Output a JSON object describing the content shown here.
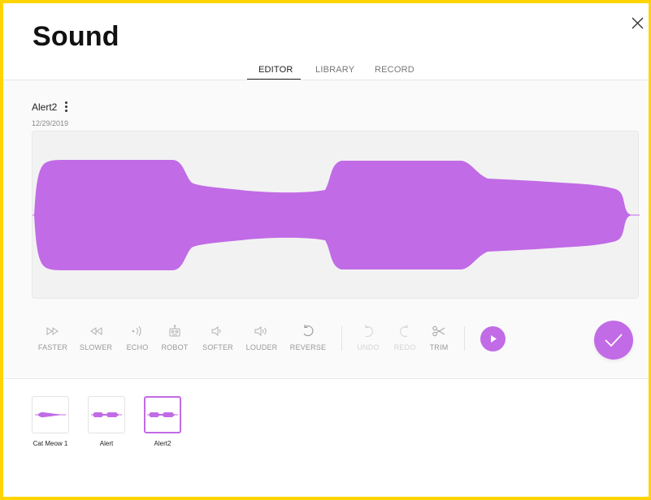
{
  "page": {
    "title": "Sound"
  },
  "tabs": [
    {
      "label": "EDITOR",
      "active": true
    },
    {
      "label": "LIBRARY",
      "active": false
    },
    {
      "label": "RECORD",
      "active": false
    }
  ],
  "sound": {
    "name": "Alert2",
    "date": "12/29/2019"
  },
  "tools": [
    {
      "label": "FASTER",
      "icon": "fast-forward-icon",
      "enabled": true
    },
    {
      "label": "SLOWER",
      "icon": "rewind-icon",
      "enabled": true
    },
    {
      "label": "ECHO",
      "icon": "echo-icon",
      "enabled": true
    },
    {
      "label": "ROBOT",
      "icon": "robot-icon",
      "enabled": true
    },
    {
      "label": "SOFTER",
      "icon": "speaker-low-icon",
      "enabled": true
    },
    {
      "label": "LOUDER",
      "icon": "speaker-high-icon",
      "enabled": true
    },
    {
      "label": "REVERSE",
      "icon": "reverse-icon",
      "enabled": true
    },
    {
      "label": "UNDO",
      "icon": "undo-icon",
      "enabled": false
    },
    {
      "label": "REDO",
      "icon": "redo-icon",
      "enabled": false
    },
    {
      "label": "TRIM",
      "icon": "scissors-icon",
      "enabled": true
    }
  ],
  "library": [
    {
      "name": "Cat Meow 1",
      "selected": false
    },
    {
      "name": "Alert",
      "selected": false
    },
    {
      "name": "Alert2",
      "selected": true
    }
  ],
  "colors": {
    "accent": "#c16be6",
    "frame": "#ffd400"
  },
  "icons": {
    "close": "close-icon",
    "play": "play-icon",
    "confirm": "check-icon",
    "menu": "kebab-menu-icon"
  }
}
